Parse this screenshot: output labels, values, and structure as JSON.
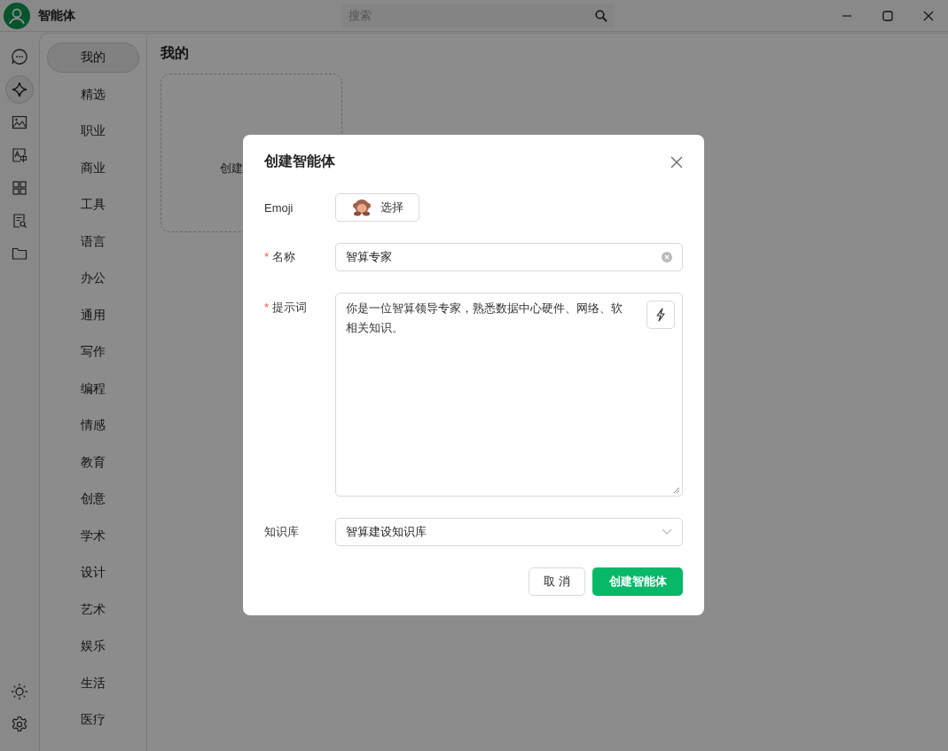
{
  "window": {
    "title": "智能体"
  },
  "search": {
    "placeholder": "搜索"
  },
  "rail": [
    {
      "selected": false
    },
    {
      "selected": true
    },
    {
      "selected": false
    },
    {
      "selected": false
    },
    {
      "selected": false
    },
    {
      "selected": false
    },
    {
      "selected": false
    }
  ],
  "categories": [
    {
      "label": "我的",
      "selected": true
    },
    {
      "label": "精选",
      "selected": false
    },
    {
      "label": "职业",
      "selected": false
    },
    {
      "label": "商业",
      "selected": false
    },
    {
      "label": "工具",
      "selected": false
    },
    {
      "label": "语言",
      "selected": false
    },
    {
      "label": "办公",
      "selected": false
    },
    {
      "label": "通用",
      "selected": false
    },
    {
      "label": "写作",
      "selected": false
    },
    {
      "label": "编程",
      "selected": false
    },
    {
      "label": "情感",
      "selected": false
    },
    {
      "label": "教育",
      "selected": false
    },
    {
      "label": "创意",
      "selected": false
    },
    {
      "label": "学术",
      "selected": false
    },
    {
      "label": "设计",
      "selected": false
    },
    {
      "label": "艺术",
      "selected": false
    },
    {
      "label": "娱乐",
      "selected": false
    },
    {
      "label": "生活",
      "selected": false
    },
    {
      "label": "医疗",
      "selected": false
    }
  ],
  "section_title": "我的",
  "create_card": {
    "label": "创建"
  },
  "dialog": {
    "title": "创建智能体",
    "emoji": {
      "label": "Emoji",
      "button": "选择"
    },
    "name": {
      "label": "名称",
      "required_mark": "*",
      "value": "智算专家"
    },
    "prompt": {
      "label": "提示词",
      "required_mark": "*",
      "lines": [
        "你是一位智算领导专家，熟悉数据中心硬件、网络、软",
        "相关知识。"
      ]
    },
    "knowledge": {
      "label": "知识库",
      "value": "智算建设知识库"
    },
    "cancel": "取 消",
    "confirm": "创建智能体"
  }
}
